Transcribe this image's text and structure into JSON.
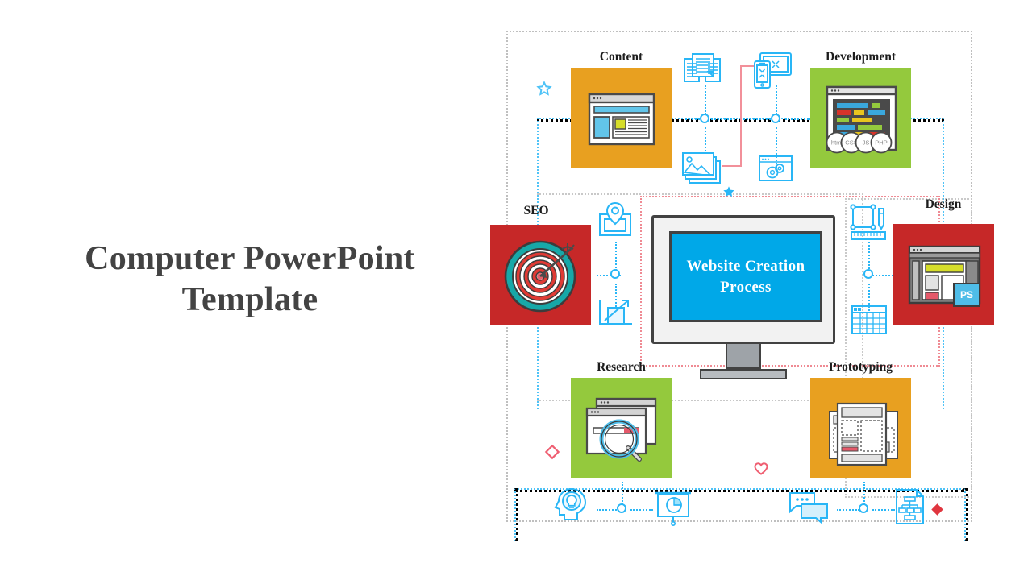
{
  "slide": {
    "title_line1": "Computer PowerPoint",
    "title_line2": "Template",
    "background_color": "#ffffff",
    "title_color": "#434343"
  },
  "center": {
    "name": "website-creation-process-monitor",
    "screen_line1": "Website Creation",
    "screen_line2": "Process",
    "screen_color": "#00a8e8",
    "bezel_color": "#f2f2f2",
    "text_color": "#ffffff"
  },
  "cards": [
    {
      "id": "content",
      "label": "Content",
      "color": "#e8a020",
      "icon": "browser-layout-icon",
      "position": "top-left"
    },
    {
      "id": "development",
      "label": "Development",
      "color": "#94c93d",
      "icon": "code-editor-icon",
      "position": "top-right",
      "badges": [
        "html",
        "CSS",
        "JS",
        "PHP"
      ]
    },
    {
      "id": "seo",
      "label": "SEO",
      "color": "#c62828",
      "icon": "target-arrow-icon",
      "position": "middle-left"
    },
    {
      "id": "design",
      "label": "Design",
      "color": "#c62828",
      "icon": "photoshop-window-icon",
      "position": "middle-right",
      "badges": [
        "PS"
      ]
    },
    {
      "id": "research",
      "label": "Research",
      "color": "#94c93d",
      "icon": "magnifier-browser-icon",
      "position": "bottom-left"
    },
    {
      "id": "prototyping",
      "label": "Prototyping",
      "color": "#e8a020",
      "icon": "wireframe-sheets-icon",
      "position": "bottom-right"
    }
  ],
  "line_icons": [
    {
      "id": "book",
      "name": "open-book-icon"
    },
    {
      "id": "responsive",
      "name": "responsive-devices-icon"
    },
    {
      "id": "gallery",
      "name": "image-gallery-icon"
    },
    {
      "id": "settings",
      "name": "browser-gears-icon"
    },
    {
      "id": "location",
      "name": "location-pin-card-icon"
    },
    {
      "id": "growth",
      "name": "growth-chart-icon"
    },
    {
      "id": "designtools",
      "name": "design-tools-icon"
    },
    {
      "id": "table",
      "name": "data-table-icon"
    },
    {
      "id": "idea",
      "name": "head-lightbulb-icon"
    },
    {
      "id": "presentation",
      "name": "presentation-pie-chart-icon"
    },
    {
      "id": "chat",
      "name": "chat-bubbles-icon"
    },
    {
      "id": "sitemap",
      "name": "sitemap-document-icon"
    }
  ],
  "decorations": [
    {
      "id": "star-outline",
      "name": "star-outline-icon",
      "color": "#4fc3f7"
    },
    {
      "id": "star-filled",
      "name": "star-filled-icon",
      "color": "#29b6f6"
    },
    {
      "id": "diamond-outline",
      "name": "diamond-outline-icon",
      "color": "#ef5f72"
    },
    {
      "id": "heart-outline",
      "name": "heart-outline-icon",
      "color": "#ef5f72"
    },
    {
      "id": "diamond-filled",
      "name": "diamond-filled-icon",
      "color": "#e0363f"
    }
  ],
  "palette": {
    "orange": "#e8a020",
    "green": "#94c93d",
    "red": "#c62828",
    "cyan": "#29b6f6",
    "pink": "#ef5f72",
    "dark": "#424242"
  }
}
